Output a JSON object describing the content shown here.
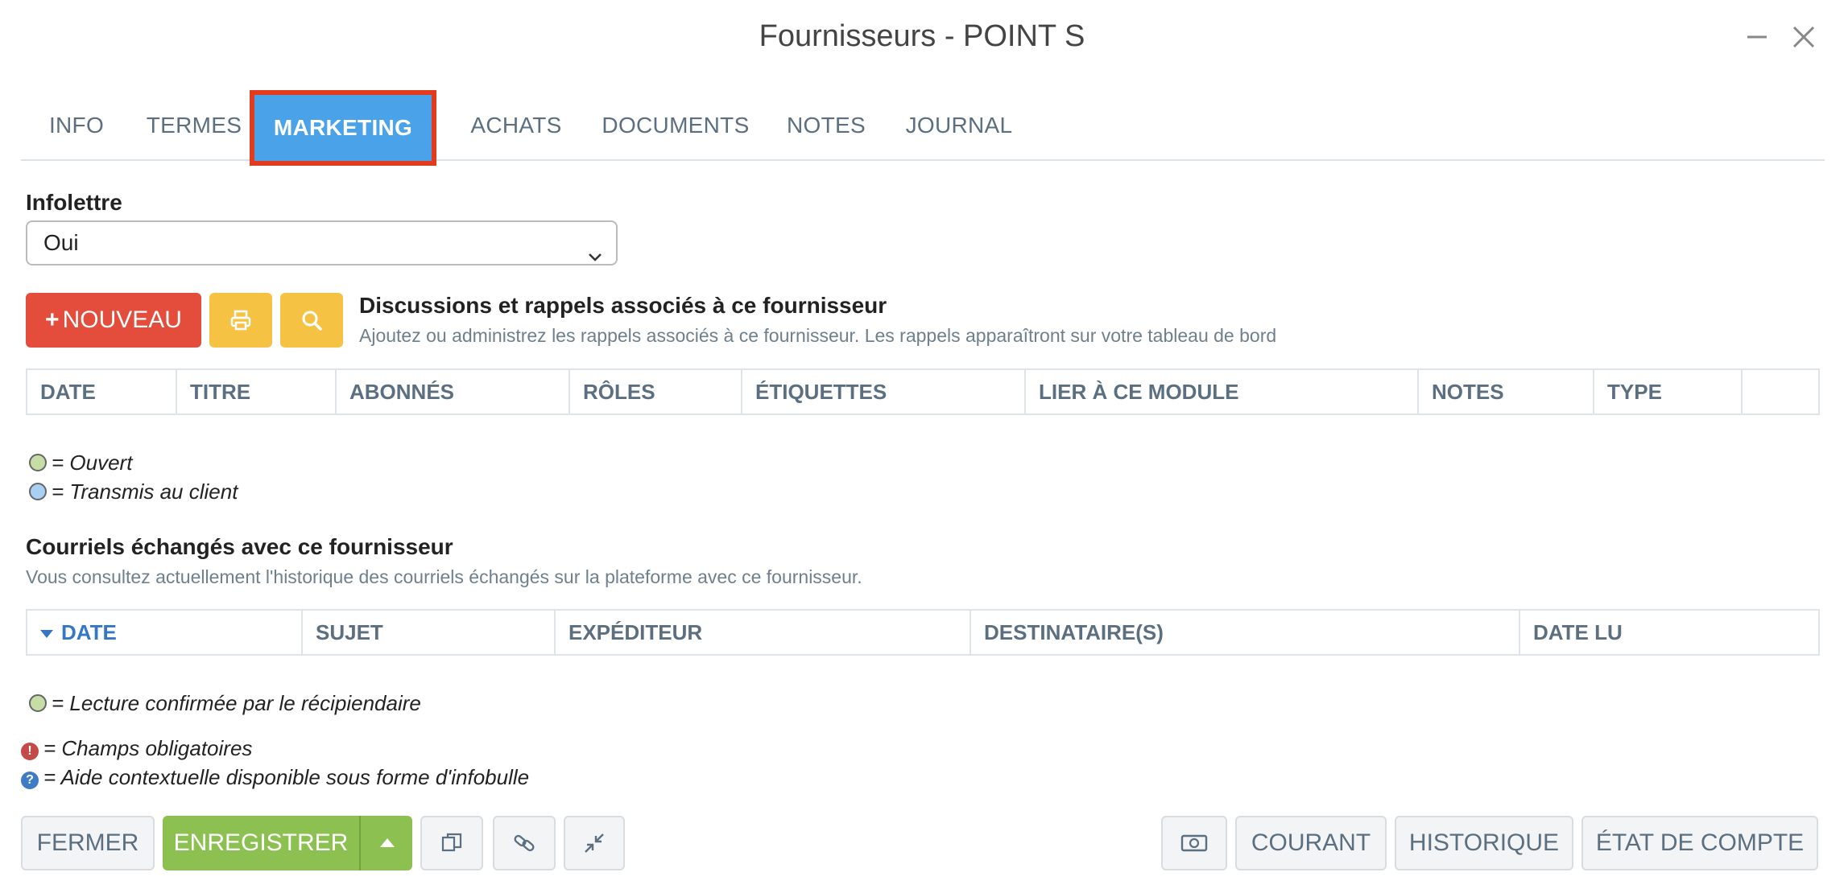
{
  "window": {
    "title": "Fournisseurs - POINT S"
  },
  "tabs": [
    {
      "label": "INFO"
    },
    {
      "label": "TERMES"
    },
    {
      "label": "MARKETING"
    },
    {
      "label": "ACHATS"
    },
    {
      "label": "DOCUMENTS"
    },
    {
      "label": "NOTES"
    },
    {
      "label": "JOURNAL"
    }
  ],
  "active_tab": "MARKETING",
  "infolettre": {
    "label": "Infolettre",
    "value": "Oui"
  },
  "reminders": {
    "new_button": "NOUVEAU",
    "title": "Discussions et rappels associés à ce fournisseur",
    "subtitle": "Ajoutez ou administrez les rappels associés à ce fournisseur. Les rappels apparaîtront sur votre tableau de bord",
    "columns": [
      "DATE",
      "TITRE",
      "ABONNÉS",
      "RÔLES",
      "ÉTIQUETTES",
      "LIER À CE MODULE",
      "NOTES",
      "TYPE"
    ],
    "legend": [
      "= Ouvert",
      "= Transmis au client"
    ]
  },
  "emails": {
    "title": "Courriels échangés avec ce fournisseur",
    "subtitle": "Vous consultez actuellement l'historique des courriels échangés sur la plateforme avec ce fournisseur.",
    "columns": [
      "DATE",
      "SUJET",
      "EXPÉDITEUR",
      "DESTINATAIRE(S)",
      "DATE LU"
    ],
    "legend": "= Lecture confirmée par le récipiendaire"
  },
  "notes": {
    "required": "= Champs obligatoires",
    "help": "= Aide contextuelle disponible sous forme d'infobulle"
  },
  "footer": {
    "close": "FERMER",
    "save": "ENREGISTRER",
    "current": "COURANT",
    "history": "HISTORIQUE",
    "statement": "ÉTAT DE COMPTE"
  },
  "colors": {
    "active_tab": "#4aa3e8",
    "active_tab_outline": "#e23b1e",
    "new_button": "#e44c3c",
    "tool_button": "#f6c244",
    "save_button": "#8cc152"
  }
}
